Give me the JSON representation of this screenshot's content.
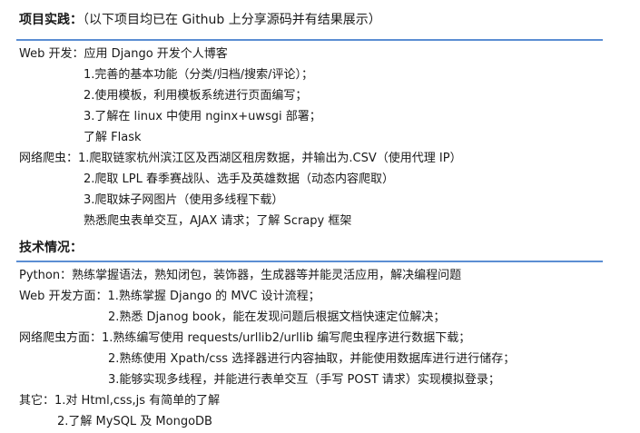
{
  "projects": {
    "title": "项目实践：",
    "note": "（以下项目均已在 Github 上分享源码并有结果展示）",
    "web": {
      "label": "Web 开发：",
      "intro": "应用 Django 开发个人博客",
      "items": [
        "1.完善的基本功能（分类/归档/搜索/评论）；",
        "2.使用模板，利用模板系统进行页面编写；",
        "3.了解在 linux 中使用 nginx+uwsgi 部署；",
        "了解 Flask"
      ]
    },
    "crawler": {
      "label": "网络爬虫：",
      "items": [
        "1.爬取链家杭州滨江区及西湖区租房数据，并输出为.CSV（使用代理 IP）",
        "2.爬取 LPL 春季赛战队、选手及英雄数据（动态内容爬取）",
        "3.爬取妹子网图片（使用多线程下载）",
        "熟悉爬虫表单交互，AJAX 请求；了解 Scrapy 框架"
      ]
    }
  },
  "skills": {
    "title": "技术情况：",
    "python": {
      "label": "Python：",
      "text": "熟练掌握语法，熟知闭包，装饰器，生成器等并能灵活应用，解决编程问题"
    },
    "web": {
      "label": "Web 开发方面：",
      "items": [
        "1.熟练掌握 Django 的 MVC 设计流程；",
        "2.熟悉 Djanog book，能在发现问题后根据文档快速定位解决；"
      ]
    },
    "crawler": {
      "label": "网络爬虫方面：",
      "items": [
        "1.熟练编写使用 requests/urllib2/urllib 编写爬虫程序进行数据下载；",
        "2.熟练使用 Xpath/css 选择器进行内容抽取，并能使用数据库进行进行储存；",
        "3.能够实现多线程，并能进行表单交互（手写 POST 请求）实现模拟登录；"
      ]
    },
    "other": {
      "label": "其它：",
      "items": [
        "1.对 Html,css,js 有简单的了解",
        "2.了解 MySQL 及 MongoDB"
      ]
    }
  },
  "colors": {
    "rule": "#5b8ed3",
    "text": "#1a1a1a"
  }
}
